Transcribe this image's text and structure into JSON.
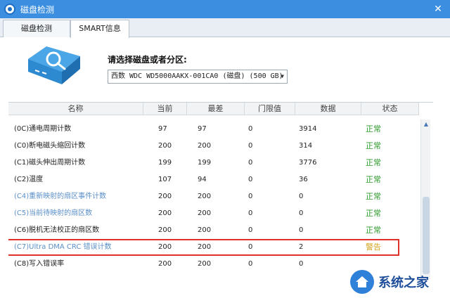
{
  "window": {
    "title": "磁盘检测",
    "close_glyph": "✕"
  },
  "tabs": [
    {
      "label": "磁盘检测"
    },
    {
      "label": "SMART信息"
    }
  ],
  "selector": {
    "prompt": "请选择磁盘或者分区:",
    "selected": "西数 WDC WD5000AAKX-001CA0 (磁盘) (500 GB)"
  },
  "table": {
    "columns": [
      "名称",
      "当前",
      "最差",
      "门限值",
      "数据",
      "状态"
    ],
    "rows": [
      {
        "name": "(0C)通电周期计数",
        "current": "97",
        "worst": "97",
        "threshold": "0",
        "data": "3914",
        "status": "正常",
        "name_color": "#222222",
        "status_color": "#2d9a2d"
      },
      {
        "name": "(C0)断电磁头缩回计数",
        "current": "200",
        "worst": "200",
        "threshold": "0",
        "data": "314",
        "status": "正常",
        "name_color": "#222222",
        "status_color": "#2d9a2d"
      },
      {
        "name": "(C1)磁头伸出周期计数",
        "current": "199",
        "worst": "199",
        "threshold": "0",
        "data": "3776",
        "status": "正常",
        "name_color": "#222222",
        "status_color": "#2d9a2d"
      },
      {
        "name": "(C2)温度",
        "current": "107",
        "worst": "94",
        "threshold": "0",
        "data": "36",
        "status": "正常",
        "name_color": "#222222",
        "status_color": "#2d9a2d"
      },
      {
        "name": "(C4)重新映射的扇区事件计数",
        "current": "200",
        "worst": "200",
        "threshold": "0",
        "data": "0",
        "status": "正常",
        "name_color": "#5a8fc8",
        "status_color": "#2d9a2d"
      },
      {
        "name": "(C5)当前待映射的扇区数",
        "current": "200",
        "worst": "200",
        "threshold": "0",
        "data": "0",
        "status": "正常",
        "name_color": "#5a8fc8",
        "status_color": "#2d9a2d"
      },
      {
        "name": "(C6)脱机无法校正的扇区数",
        "current": "200",
        "worst": "200",
        "threshold": "0",
        "data": "0",
        "status": "正常",
        "name_color": "#222222",
        "status_color": "#2d9a2d"
      },
      {
        "name": "(C7)Ultra DMA CRC 错误计数",
        "current": "200",
        "worst": "200",
        "threshold": "0",
        "data": "2",
        "status": "警告",
        "name_color": "#5a8fc8",
        "status_color": "#d6a21c",
        "highlight": true
      },
      {
        "name": "(C8)写入错误率",
        "current": "200",
        "worst": "200",
        "threshold": "0",
        "data": "0",
        "status": "",
        "name_color": "#222222",
        "status_color": "#2d9a2d"
      }
    ]
  },
  "watermark": {
    "text": "系统之家"
  },
  "colors": {
    "titlebar": "#3c8fe0",
    "ok": "#2d9a2d",
    "warning": "#d6a21c",
    "highlight_border": "#e0302a"
  }
}
